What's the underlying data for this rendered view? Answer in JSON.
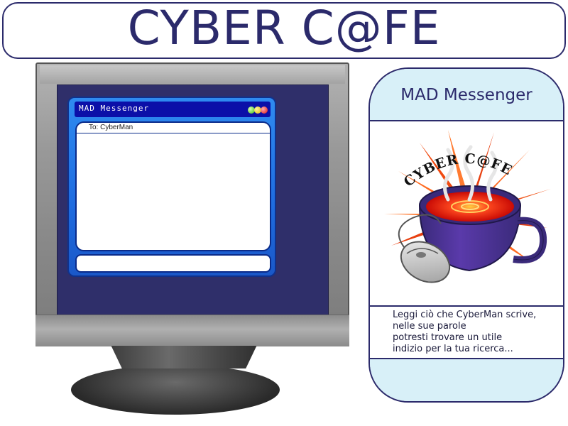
{
  "header": {
    "title": "CYBER C@FE"
  },
  "messenger": {
    "window_title": "MAD Messenger",
    "to_label": "To: CyberMan",
    "compose_value": ""
  },
  "panel": {
    "title": "MAD Messenger",
    "logo_text": "CYBER C@FE",
    "description_lines": [
      "Leggi ciò che CyberMan scrive,",
      "nelle sue parole",
      "potresti trovare un utile",
      "indizio per la tua ricerca..."
    ]
  },
  "icons": {
    "window_lights": [
      "green-light-icon",
      "yellow-light-icon",
      "red-light-icon"
    ],
    "logo": "coffee-cup-mouse-logo"
  },
  "colors": {
    "brand_navy": "#2b2a6b",
    "panel_band": "#d8f0f8",
    "messenger_blue": "#1f6ce0",
    "titlebar_blue": "#0b0fa8",
    "screen_bg": "#2f2f6a"
  }
}
